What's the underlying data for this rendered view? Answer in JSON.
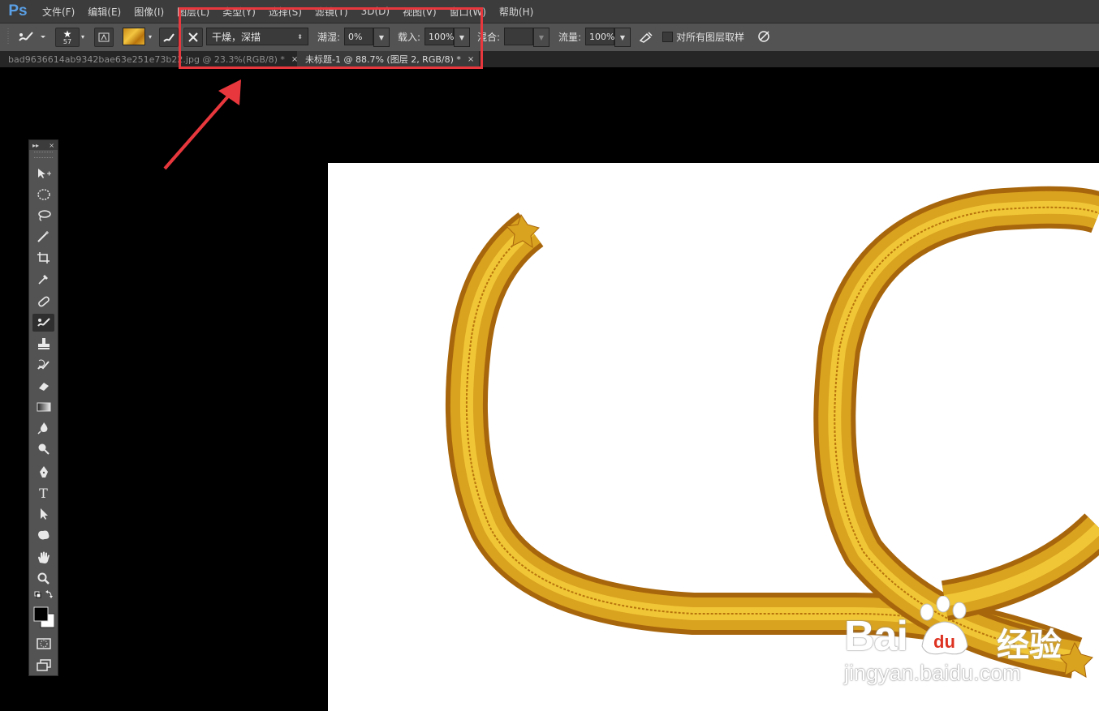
{
  "app": {
    "logo": "Ps"
  },
  "menu": [
    "文件(F)",
    "编辑(E)",
    "图像(I)",
    "图层(L)",
    "类型(Y)",
    "选择(S)",
    "滤镜(T)",
    "3D(D)",
    "视图(V)",
    "窗口(W)",
    "帮助(H)"
  ],
  "options": {
    "brush_size": "57",
    "preset": "干燥，深描",
    "wet_label": "潮湿:",
    "wet_value": "0%",
    "load_label": "载入:",
    "load_value": "100%",
    "mix_label": "混合:",
    "mix_value": "",
    "flow_label": "流量:",
    "flow_value": "100%",
    "sample_all_label": "对所有图层取样",
    "sample_all_checked": false
  },
  "tabs": [
    {
      "label": "bad9636614ab9342bae63e251e73b22.jpg @ 23.3%(RGB/8) *",
      "active": false
    },
    {
      "label": "未标题-1 @ 88.7% (图层 2, RGB/8) *",
      "active": true
    }
  ],
  "tab_close": "×",
  "toolbox": {
    "collapse": "▸▸",
    "close": "×",
    "type_tool": "T"
  },
  "watermark": {
    "brand": "Bai",
    "brand_suffix": "经验",
    "url": "jingyan.baidu.com"
  },
  "colors": {
    "highlight": "#e8383d",
    "stroke_gold": "#d9a21f",
    "stroke_dark": "#a8660c"
  }
}
